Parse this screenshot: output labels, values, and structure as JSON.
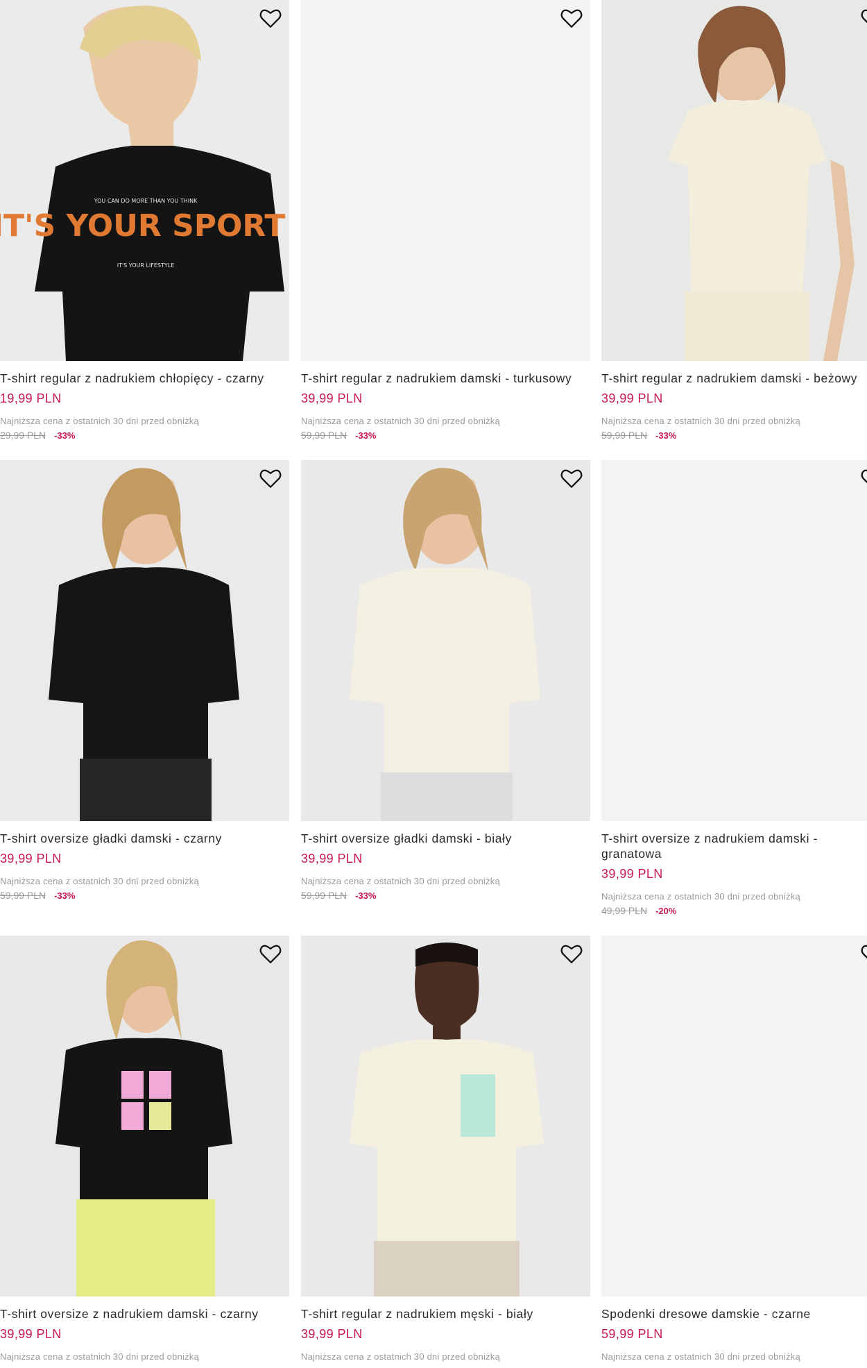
{
  "products": [
    {
      "title": "T-shirt regular z nadrukiem chłopięcy - czarny",
      "price": "19,99 PLN",
      "lowest_label": "Najniższa cena z ostatnich 30 dni przed obniżką",
      "old_price": "29,99 PLN",
      "discount": "-33%",
      "graphic": "IT'S YOUR SPORT!",
      "graphic_top": "YOU CAN DO MORE THAN YOU THINK",
      "graphic_bottom": "IT'S YOUR LIFESTYLE"
    },
    {
      "title": "T-shirt regular z nadrukiem damski - turkusowy",
      "price": "39,99 PLN",
      "lowest_label": "Najniższa cena z ostatnich 30 dni przed obniżką",
      "old_price": "59,99 PLN",
      "discount": "-33%"
    },
    {
      "title": "T-shirt regular z nadrukiem damski - beżowy",
      "price": "39,99 PLN",
      "lowest_label": "Najniższa cena z ostatnich 30 dni przed obniżką",
      "old_price": "59,99 PLN",
      "discount": "-33%"
    },
    {
      "title": "T-shirt oversize gładki damski - czarny",
      "price": "39,99 PLN",
      "lowest_label": "Najniższa cena z ostatnich 30 dni przed obniżką",
      "old_price": "59,99 PLN",
      "discount": "-33%"
    },
    {
      "title": "T-shirt oversize gładki damski - biały",
      "price": "39,99 PLN",
      "lowest_label": "Najniższa cena z ostatnich 30 dni przed obniżką",
      "old_price": "59,99 PLN",
      "discount": "-33%"
    },
    {
      "title": "T-shirt oversize z nadrukiem damski - granatowa",
      "price": "39,99 PLN",
      "lowest_label": "Najniższa cena z ostatnich 30 dni przed obniżką",
      "old_price": "49,99 PLN",
      "discount": "-20%"
    },
    {
      "title": "T-shirt oversize z nadrukiem damski - czarny",
      "price": "39,99 PLN",
      "lowest_label": "Najniższa cena z ostatnich 30 dni przed obniżką"
    },
    {
      "title": "T-shirt regular z nadrukiem męski - biały",
      "price": "39,99 PLN",
      "lowest_label": "Najniższa cena z ostatnich 30 dni przed obniżką"
    },
    {
      "title": "Spodenki dresowe damskie - czarne",
      "price": "59,99 PLN",
      "lowest_label": "Najniższa cena z ostatnich 30 dni przed obniżką"
    }
  ],
  "icons": {
    "favorite": "heart-outline-icon"
  },
  "colors": {
    "price": "#c8174f",
    "muted": "#9a9a9a",
    "image_bg": "#ededed"
  }
}
